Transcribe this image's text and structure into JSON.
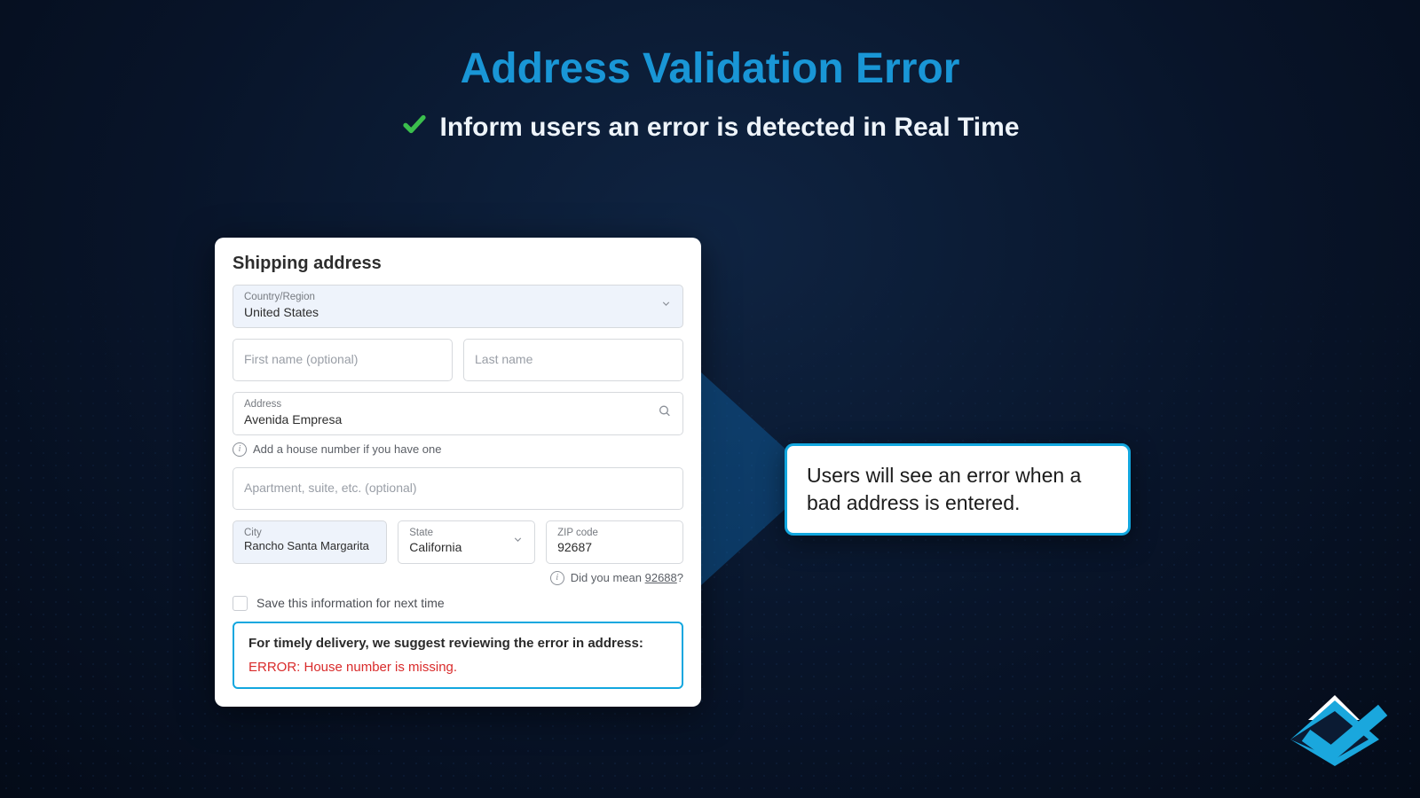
{
  "title": "Address Validation Error",
  "subtitle": "Inform users an error is detected in Real Time",
  "form": {
    "heading": "Shipping address",
    "country": {
      "label": "Country/Region",
      "value": "United States"
    },
    "first_name_placeholder": "First name (optional)",
    "last_name_placeholder": "Last name",
    "address": {
      "label": "Address",
      "value": "Avenida Empresa"
    },
    "address_hint": "Add a house number if you have one",
    "apt_placeholder": "Apartment, suite, etc. (optional)",
    "city": {
      "label": "City",
      "value": "Rancho Santa Margarita"
    },
    "state": {
      "label": "State",
      "value": "California"
    },
    "zip": {
      "label": "ZIP code",
      "value": "92687"
    },
    "zip_hint_prefix": "Did you mean ",
    "zip_hint_value": "92688",
    "zip_hint_suffix": "?",
    "save_label": "Save this information for next time",
    "error_lead": "For timely delivery, we suggest reviewing the error in address:",
    "error_msg": "ERROR: House number is missing."
  },
  "callout": "Users will see an error when a bad address is entered."
}
